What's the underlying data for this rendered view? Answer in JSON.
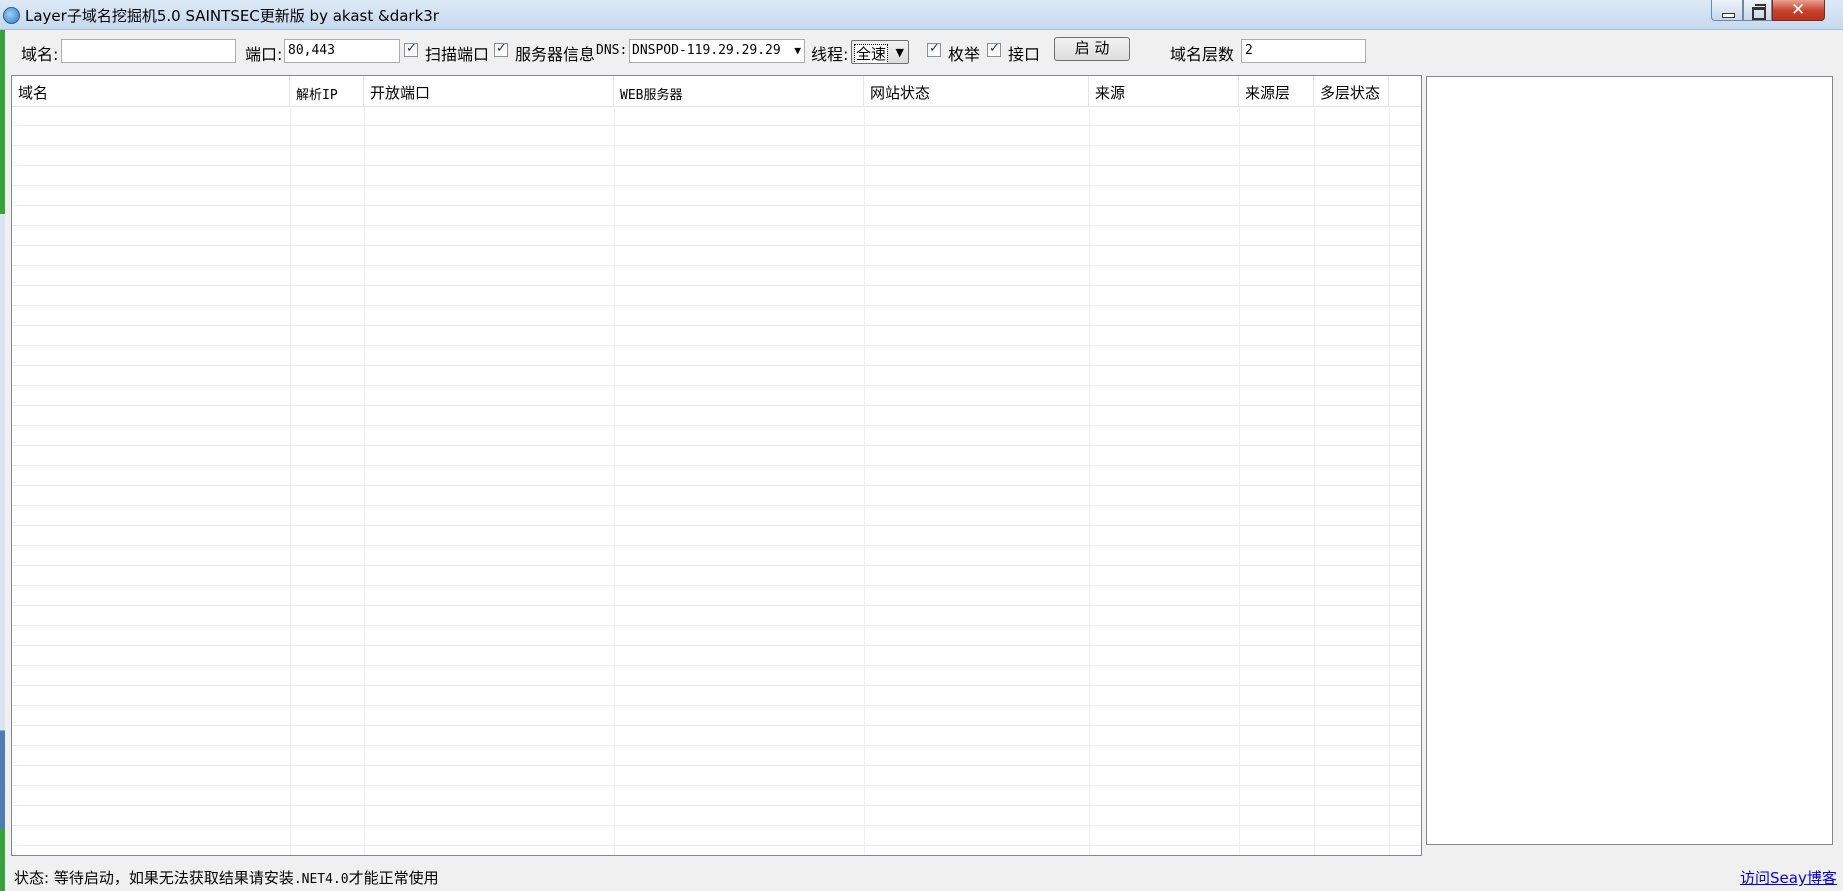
{
  "window": {
    "title": "Layer子域名挖掘机5.0 SAINTSEC更新版 by akast &dark3r"
  },
  "toolbar": {
    "domain_label": "域名:",
    "domain_value": "",
    "port_label": "端口:",
    "port_value": "80,443",
    "scan_port_label": "扫描端口",
    "scan_port_checked": true,
    "server_info_label": "服务器信息",
    "server_info_checked": true,
    "dns_label": "DNS:",
    "dns_value": "DNSPOD-119.29.29.29",
    "thread_label": "线程:",
    "thread_value": "全速",
    "enum_label": "枚举",
    "enum_checked": true,
    "api_label": "接口",
    "api_checked": true,
    "start_button": "启 动",
    "depth_label": "域名层数",
    "depth_value": "2"
  },
  "table": {
    "columns": [
      "域名",
      "解析IP",
      "开放端口",
      "WEB服务器",
      "网站状态",
      "来源",
      "来源层",
      "多层状态"
    ],
    "rows": []
  },
  "status": {
    "prefix": "状态: 等待启动，如果无法获取结果请安装",
    "net": ".NET4.0",
    "suffix": "才能正常使用",
    "link": "访问Seay博客"
  },
  "colors": {
    "accent_green": "#36a43a",
    "link_blue": "#0000ee",
    "close_red": "#c7412b"
  }
}
